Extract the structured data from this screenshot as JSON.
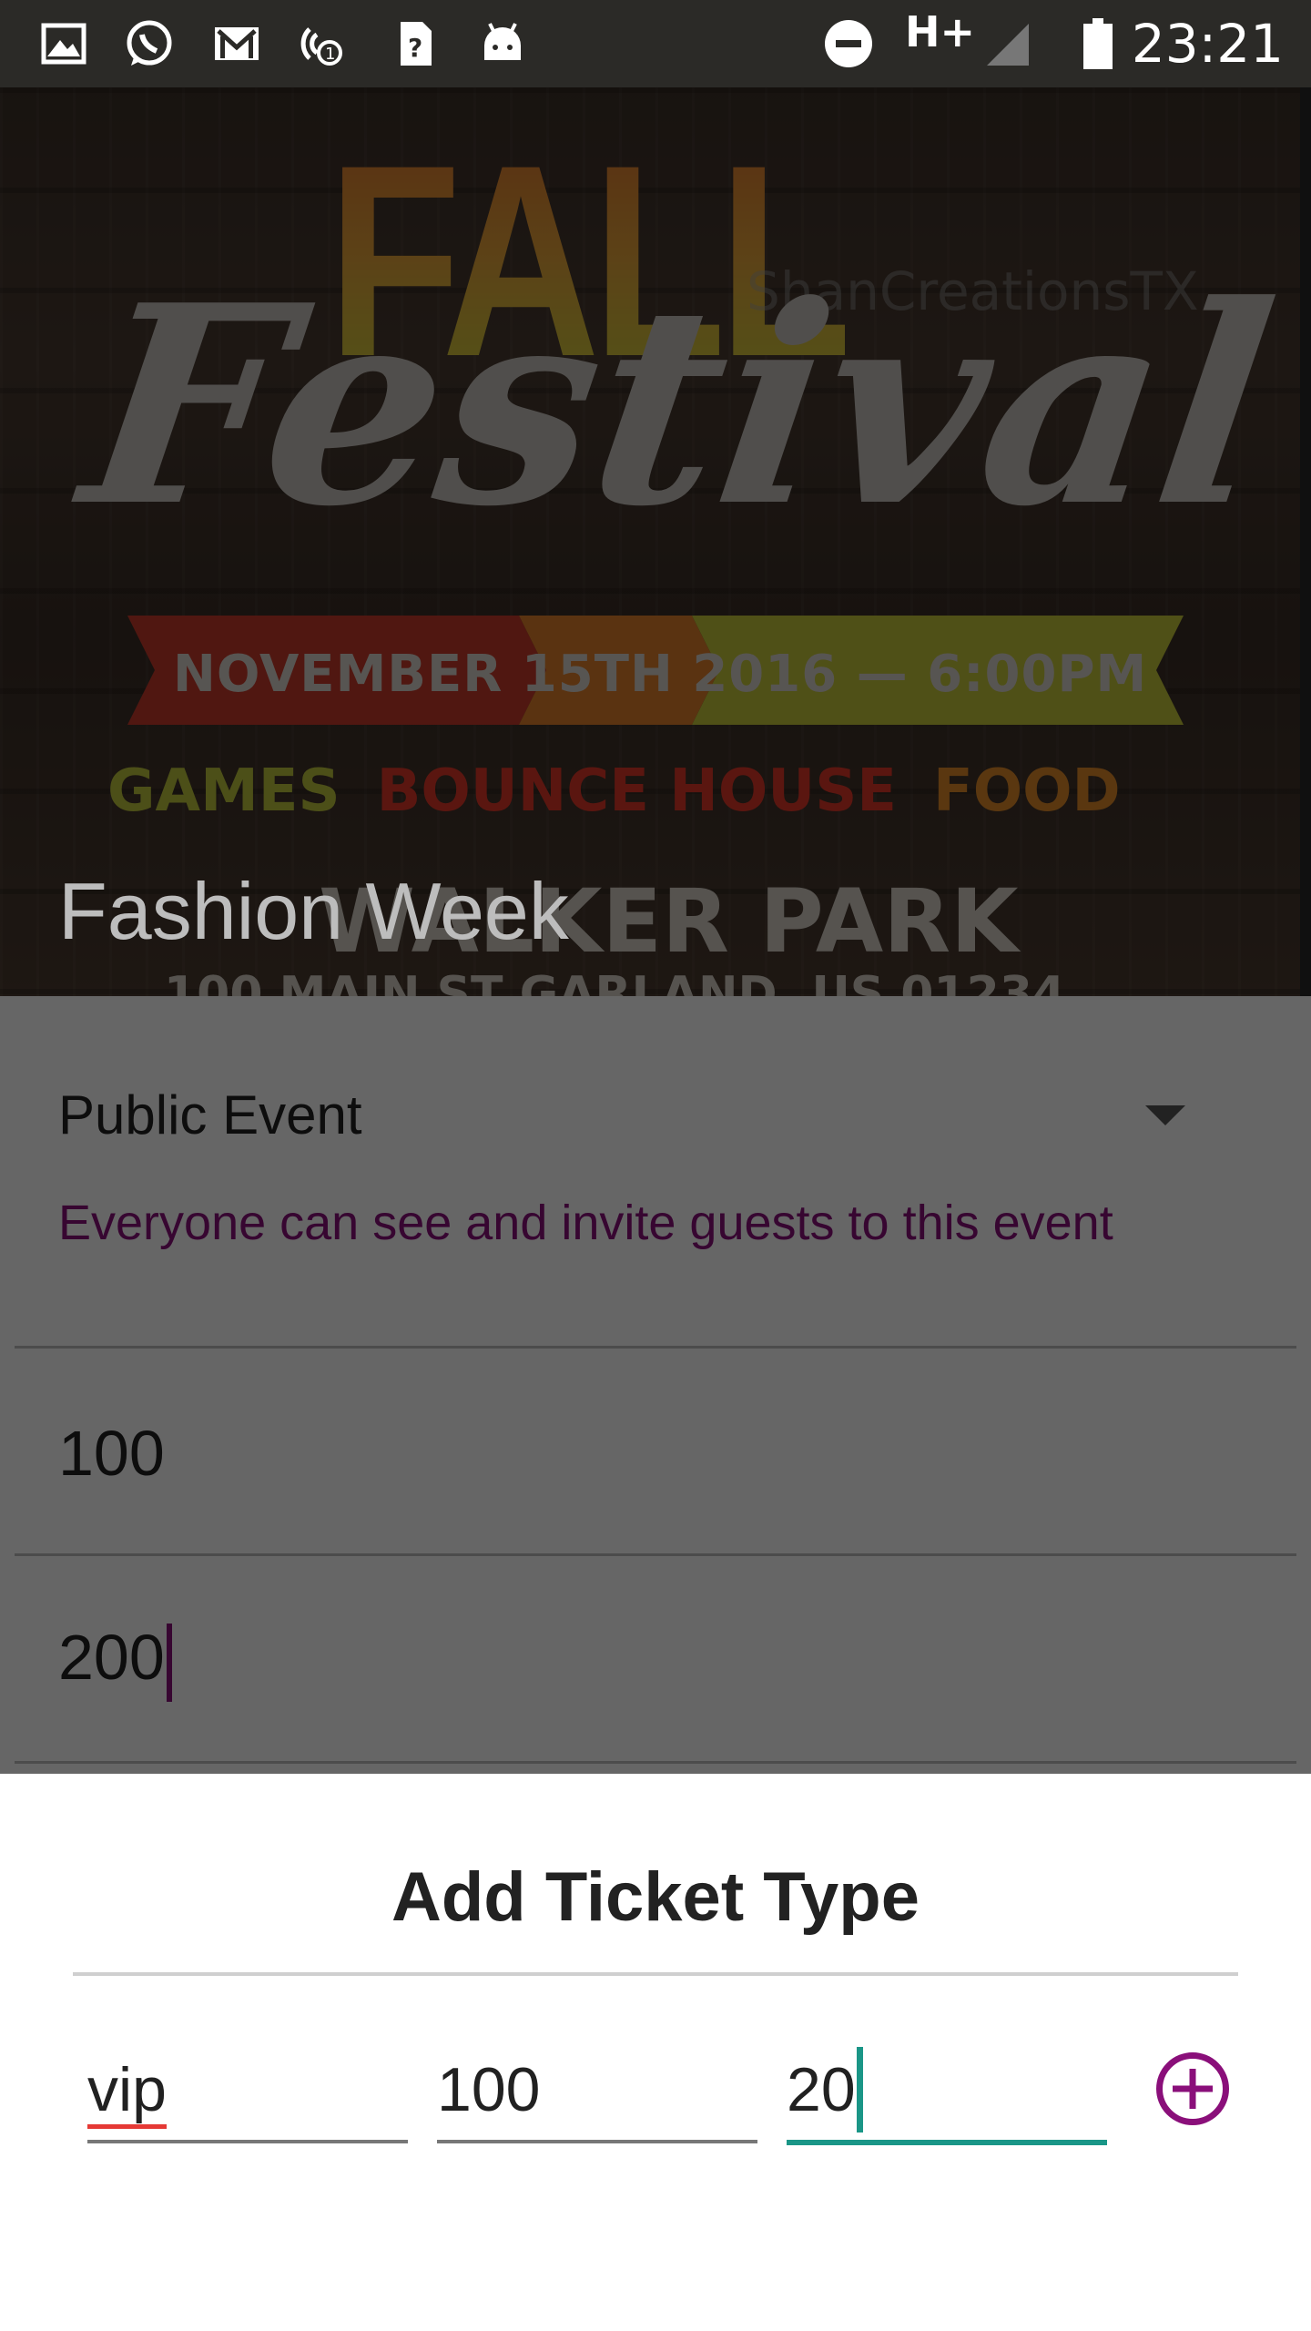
{
  "status_bar": {
    "time": "23:21",
    "network": "H+",
    "icons": [
      "image-icon",
      "whatsapp-icon",
      "gmail-icon",
      "hotspot-icon",
      "sim-unknown-icon",
      "android-icon",
      "dnd-icon",
      "network-type-icon",
      "signal-icon",
      "battery-icon"
    ]
  },
  "banner": {
    "line1": "FALL",
    "line2": "Festival",
    "watermark": "ShanCreationsTX",
    "ribbon": "NOVEMBER 15TH 2016 — 6:00PM",
    "features": [
      "GAMES",
      "BOUNCE HOUSE",
      "FOOD"
    ],
    "park": "WALKER PARK",
    "address": "100 MAIN ST GARLAND, US 01234"
  },
  "event": {
    "title": "Fashion Week",
    "privacy": {
      "selected": "Public Event",
      "help": "Everyone can see and invite guests to this event"
    },
    "field1_value": "100",
    "field2_value": "200"
  },
  "sheet": {
    "title": "Add Ticket Type",
    "ticket_name": "vip",
    "ticket_price": "100",
    "ticket_quantity": "20"
  },
  "colors": {
    "accent": "#8a0f7a",
    "teal": "#1a9687",
    "status_bar": "#2b2a27"
  }
}
